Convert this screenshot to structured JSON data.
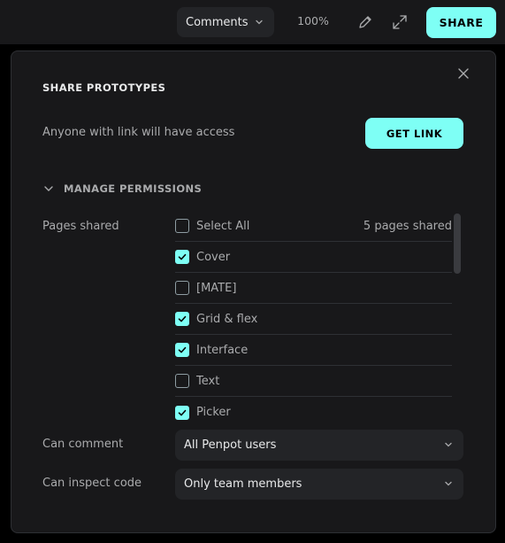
{
  "topbar": {
    "mode_select": {
      "value": "Comments",
      "icon": "chevron-down-icon"
    },
    "zoom": "100%",
    "edit_icon": "pencil-icon",
    "fullscreen_icon": "expand-icon",
    "share_label": "SHARE"
  },
  "dialog": {
    "title": "SHARE PROTOTYPES",
    "access_text": "Anyone with link will have access",
    "get_link_label": "GET LINK",
    "manage_permissions_label": "MANAGE PERMISSIONS",
    "pages_shared_label": "Pages shared",
    "select_all_label": "Select All",
    "pages_count": "5 pages shared",
    "pages": [
      {
        "name": "Cover",
        "checked": true
      },
      {
        "name": "[MATE]",
        "checked": false
      },
      {
        "name": "Grid & flex",
        "checked": true
      },
      {
        "name": "Interface",
        "checked": true
      },
      {
        "name": "Text",
        "checked": false
      },
      {
        "name": "Picker",
        "checked": true
      }
    ],
    "can_comment_label": "Can comment",
    "can_comment_value": "All Penpot users",
    "can_inspect_label": "Can inspect code",
    "can_inspect_value": "Only team members"
  },
  "colors": {
    "accent": "#7efff5",
    "background": "#18181a",
    "surface": "#232427",
    "text_primary": "#e8e9ea",
    "text_secondary": "#aaabad"
  }
}
